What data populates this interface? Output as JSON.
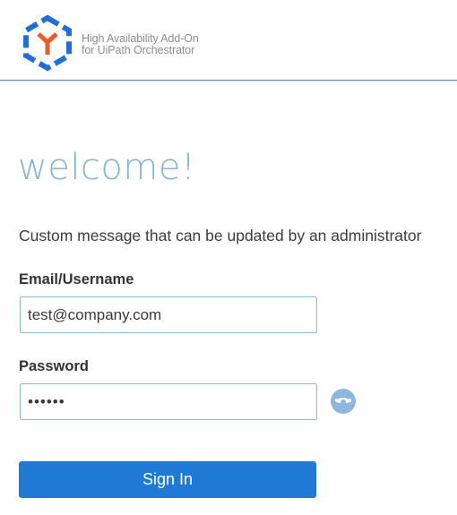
{
  "header": {
    "logo_icon": "uipath-ha-addon-logo-icon",
    "logo_line1": "High Availability Add-On",
    "logo_line2": "for UiPath Orchestrator",
    "accent_color": "#3f7fc1",
    "logo_hex_color": "#1f6fd6",
    "logo_y_color": "#f05a28"
  },
  "main": {
    "welcome": "welcome!",
    "message": "Custom message that can be updated by an administrator",
    "email": {
      "label": "Email/Username",
      "value": "test@company.com"
    },
    "password": {
      "label": "Password",
      "value": "••••••",
      "reveal_icon": "eye-icon"
    },
    "signin_label": "Sign In",
    "signin_color": "#1f7ad6"
  }
}
